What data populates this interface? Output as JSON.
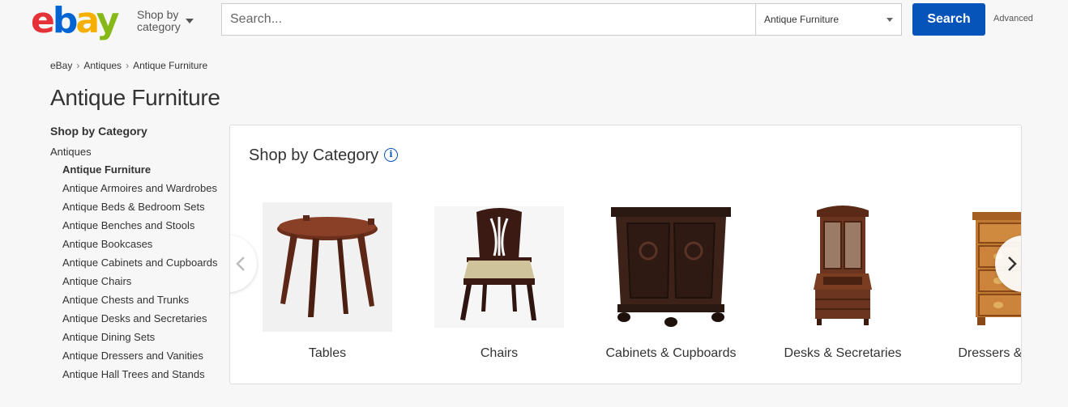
{
  "header": {
    "logo_letters": [
      "e",
      "b",
      "a",
      "y"
    ],
    "logo_colors": [
      "#e53238",
      "#0064d2",
      "#f5af02",
      "#86b817"
    ],
    "shop_by_line1": "Shop by",
    "shop_by_line2": "category",
    "search_placeholder": "Search...",
    "search_value": "",
    "category_selected": "Antique Furniture",
    "search_button": "Search",
    "advanced_link": "Advanced",
    "accent_color": "#0654ba"
  },
  "breadcrumb": [
    "eBay",
    "Antiques",
    "Antique Furniture"
  ],
  "page_title": "Antique Furniture",
  "sidebar": {
    "heading": "Shop by Category",
    "parent": "Antiques",
    "items": [
      "Antique Furniture",
      "Antique Armoires and Wardrobes",
      "Antique Beds & Bedroom Sets",
      "Antique Benches and Stools",
      "Antique Bookcases",
      "Antique Cabinets and Cupboards",
      "Antique Chairs",
      "Antique Chests and Trunks",
      "Antique Desks and Secretaries",
      "Antique Dining Sets",
      "Antique Dressers and Vanities",
      "Antique Hall Trees and Stands"
    ],
    "active_index": 0
  },
  "carousel": {
    "title": "Shop by Category",
    "info_icon": "info-icon",
    "items": [
      {
        "label": "Tables",
        "icon": "table-image"
      },
      {
        "label": "Chairs",
        "icon": "chair-image"
      },
      {
        "label": "Cabinets & Cupboards",
        "icon": "cabinet-image"
      },
      {
        "label": "Desks & Secretaries",
        "icon": "secretary-desk-image"
      },
      {
        "label": "Dressers & Vanities",
        "icon": "dresser-image"
      }
    ],
    "prev_icon": "chevron-left-icon",
    "next_icon": "chevron-right-icon"
  }
}
